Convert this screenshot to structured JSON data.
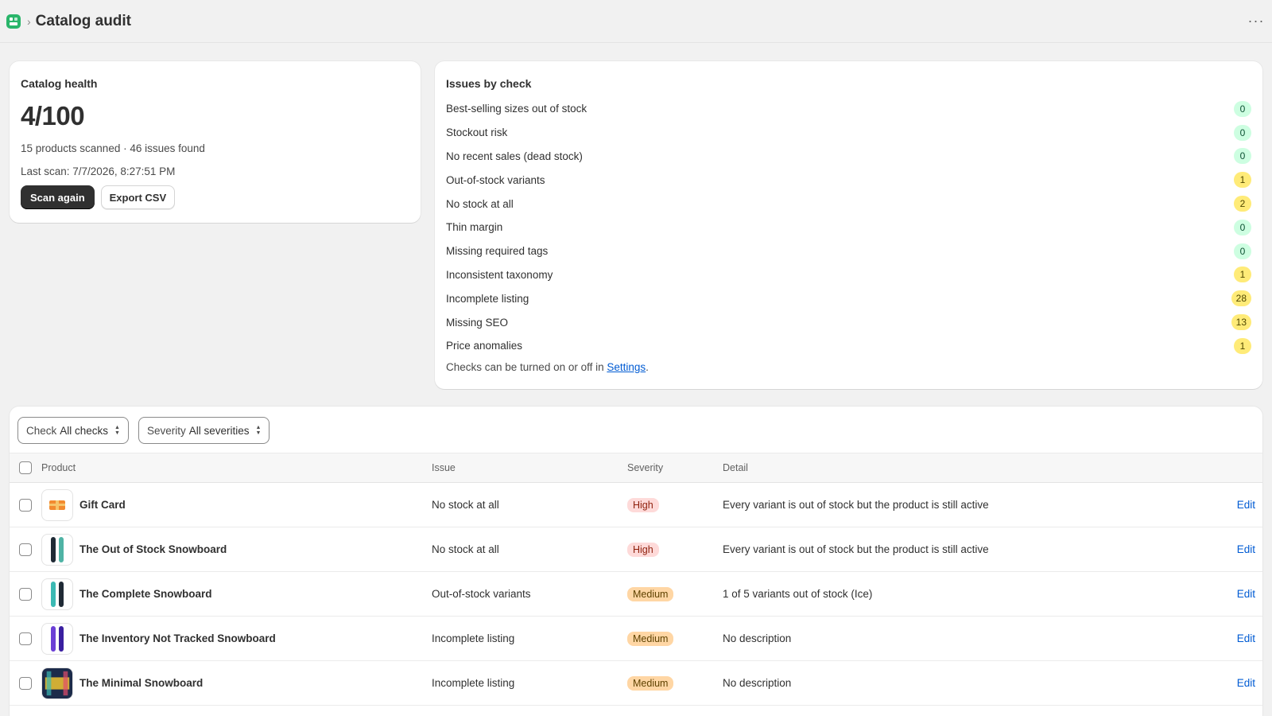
{
  "header": {
    "title": "Catalog audit",
    "app_icon": "app-icon",
    "more_label": "···"
  },
  "health": {
    "title": "Catalog health",
    "score": "4/100",
    "summary": "15 products scanned · 46 issues found",
    "last_scan": "Last scan: 7/7/2026, 8:27:51 PM",
    "scan_label": "Scan again",
    "export_label": "Export CSV"
  },
  "issues_card": {
    "title": "Issues by check",
    "checks": [
      {
        "label": "Best-selling sizes out of stock",
        "count": "0",
        "level": "zero"
      },
      {
        "label": "Stockout risk",
        "count": "0",
        "level": "zero"
      },
      {
        "label": "No recent sales (dead stock)",
        "count": "0",
        "level": "zero"
      },
      {
        "label": "Out-of-stock variants",
        "count": "1",
        "level": "warn"
      },
      {
        "label": "No stock at all",
        "count": "2",
        "level": "warn"
      },
      {
        "label": "Thin margin",
        "count": "0",
        "level": "zero"
      },
      {
        "label": "Missing required tags",
        "count": "0",
        "level": "zero"
      },
      {
        "label": "Inconsistent taxonomy",
        "count": "1",
        "level": "warn"
      },
      {
        "label": "Incomplete listing",
        "count": "28",
        "level": "warn"
      },
      {
        "label": "Missing SEO",
        "count": "13",
        "level": "warn"
      },
      {
        "label": "Price anomalies",
        "count": "1",
        "level": "warn"
      }
    ],
    "footnote_prefix": "Checks can be turned on or off in ",
    "footnote_link": "Settings",
    "footnote_suffix": "."
  },
  "filters": {
    "check_label": "Check",
    "check_value": "All checks",
    "severity_label": "Severity",
    "severity_value": "All severities"
  },
  "table": {
    "headers": {
      "product": "Product",
      "issue": "Issue",
      "severity": "Severity",
      "detail": "Detail"
    },
    "rows": [
      {
        "product": "Gift Card",
        "issue": "No stock at all",
        "severity": "High",
        "sev_level": "high",
        "detail": "Every variant is out of stock but the product is still active",
        "action": "Edit",
        "thumb": "gift-card-thumbnail"
      },
      {
        "product": "The Out of Stock Snowboard",
        "issue": "No stock at all",
        "severity": "High",
        "sev_level": "high",
        "detail": "Every variant is out of stock but the product is still active",
        "action": "Edit",
        "thumb": "snowboard-thumbnail"
      },
      {
        "product": "The Complete Snowboard",
        "issue": "Out-of-stock variants",
        "severity": "Medium",
        "sev_level": "medium",
        "detail": "1 of 5 variants out of stock (Ice)",
        "action": "Edit",
        "thumb": "snowboard-thumbnail"
      },
      {
        "product": "The Inventory Not Tracked Snowboard",
        "issue": "Incomplete listing",
        "severity": "Medium",
        "sev_level": "medium",
        "detail": "No description",
        "action": "Edit",
        "thumb": "snowboard-thumbnail"
      },
      {
        "product": "The Minimal Snowboard",
        "issue": "Incomplete listing",
        "severity": "Medium",
        "sev_level": "medium",
        "detail": "No description",
        "action": "Edit",
        "thumb": "snowboard-thumbnail"
      }
    ]
  },
  "colors": {
    "badge_zero_bg": "#cdfee1",
    "badge_warn_bg": "#ffeb78",
    "sev_high_bg": "#fedad9",
    "sev_medium_bg": "#ffd6a4",
    "link": "#005bd3"
  }
}
